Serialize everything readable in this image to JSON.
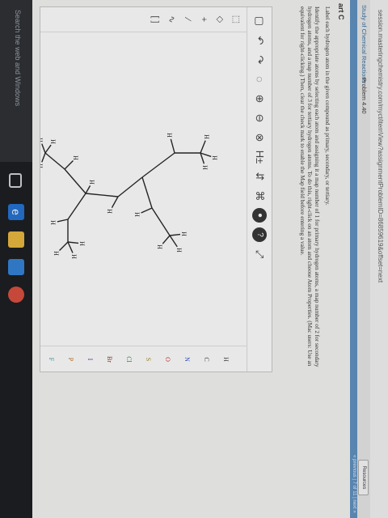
{
  "browser": {
    "url": "session.masteringchemistry.com/myct/itemView?assignmentProblemID=86859619&offset=next"
  },
  "breadcrumb": {
    "link": "Study of Chemical Reactions",
    "separator": "›",
    "current": "Problem 4.40"
  },
  "header": {
    "resources_label": "Resources",
    "pager": "« previous | 7 of 11 | next »"
  },
  "problem": {
    "part_title": "art C",
    "instruction_1": "Label each hydrogen atom in the given compound as primary, secondary, or tertiary.",
    "instruction_2": "Identify the appropriate atoms by selecting each atom and assigning it a map number of 1 for primary hydrogen atoms, a map number of 2 for secondary hydrogen atoms, and a map number of 3 for tertiary hydrogen atoms. To do this, right-click on an atom and choose Atom Properties. (Mac users: Use an equivalent for right-clicking.) Then, clear the check mark to enable the Map field before entering a value."
  },
  "editor": {
    "top_tools": [
      {
        "name": "new-document-icon",
        "glyph": "▢"
      },
      {
        "name": "undo-icon",
        "glyph": "↶"
      },
      {
        "name": "redo-icon",
        "glyph": "↷"
      },
      {
        "name": "clean-icon",
        "glyph": "◌"
      },
      {
        "name": "zoom-in-icon",
        "glyph": "⊕"
      },
      {
        "name": "zoom-out-icon",
        "glyph": "⊖"
      },
      {
        "name": "zoom-fit-icon",
        "glyph": "⊗"
      },
      {
        "name": "explicit-hydrogens-icon",
        "glyph": "H±"
      },
      {
        "name": "stereo-icon",
        "glyph": "⇵"
      },
      {
        "name": "template-icon",
        "glyph": "⌘"
      },
      {
        "name": "info-icon",
        "glyph": "●"
      },
      {
        "name": "help-icon",
        "glyph": "?"
      },
      {
        "name": "fullscreen-icon",
        "glyph": "⤢"
      }
    ],
    "left_tools": [
      {
        "name": "select-tool-icon",
        "glyph": "⬚"
      },
      {
        "name": "eraser-icon",
        "glyph": "◇"
      },
      {
        "name": "charge-plus-icon",
        "glyph": "+"
      },
      {
        "name": "bond-tool-icon",
        "glyph": "⁄"
      },
      {
        "name": "chain-tool-icon",
        "glyph": "∿"
      },
      {
        "name": "bracket-tool-icon",
        "glyph": "[ ]"
      }
    ],
    "elements": [
      {
        "symbol": "H",
        "color": "#444444"
      },
      {
        "symbol": "C",
        "color": "#444444"
      },
      {
        "symbol": "N",
        "color": "#2f55c8"
      },
      {
        "symbol": "O",
        "color": "#d02a2a"
      },
      {
        "symbol": "S",
        "color": "#a88a10"
      },
      {
        "symbol": "Cl",
        "color": "#2a9a3a"
      },
      {
        "symbol": "Br",
        "color": "#8a3a1a"
      },
      {
        "symbol": "I",
        "color": "#6a2a9a"
      },
      {
        "symbol": "P",
        "color": "#c86a10"
      },
      {
        "symbol": "F",
        "color": "#3a9aa0"
      }
    ],
    "atom_label": "H"
  },
  "taskbar": {
    "search_text": "Search the web and Windows"
  },
  "colors": {
    "accent": "#5c8fbf",
    "link": "#2e6da4"
  }
}
